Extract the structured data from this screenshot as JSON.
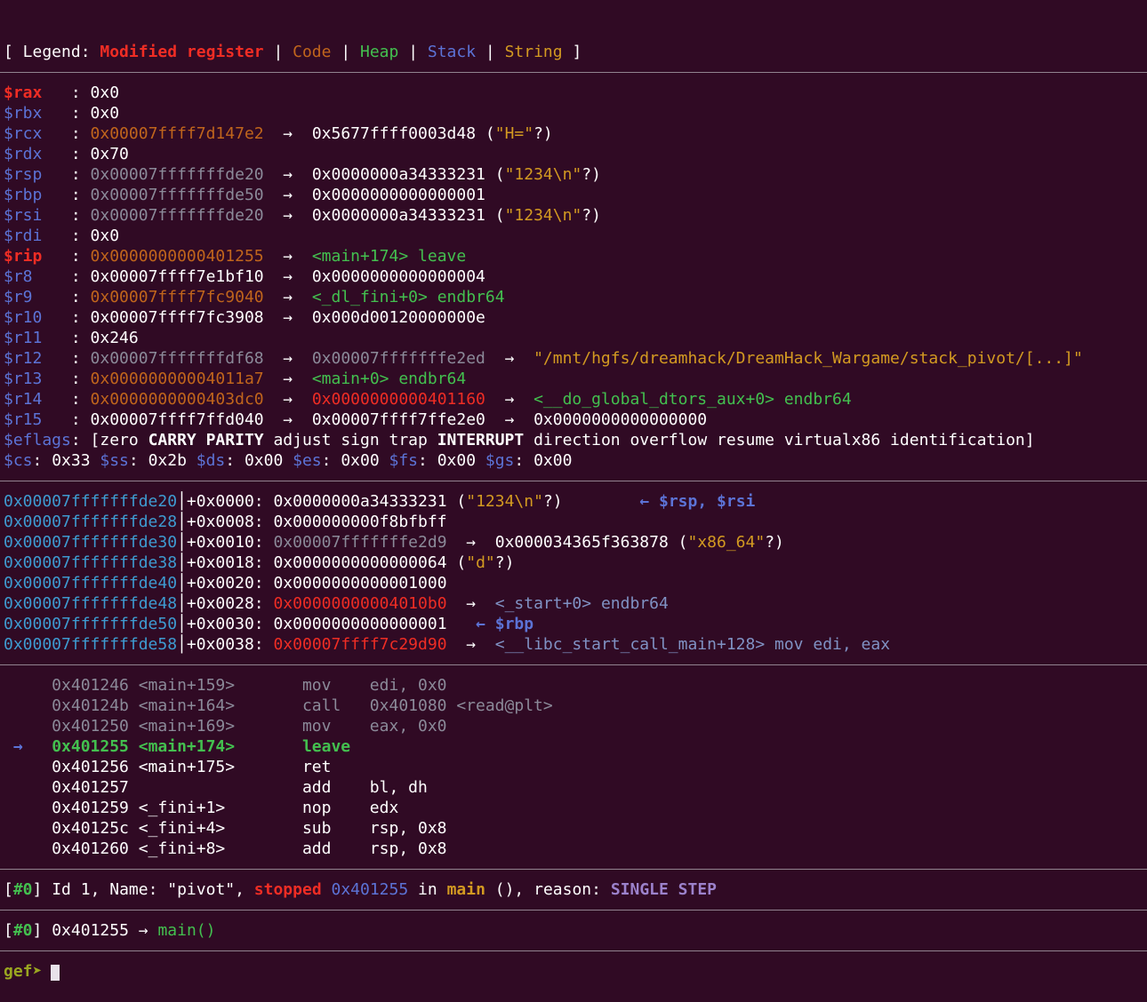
{
  "palette": {
    "bg": "#300a24",
    "fg": "#ffffff",
    "dim": "#8b8a99",
    "red": "#ef2d24",
    "code": "#c0651c",
    "gold": "#d39a21",
    "green": "#43c04f",
    "blue": "#5c73d6",
    "cyan": "#3e9bd1",
    "purple": "#9c82cc",
    "slate": "#8092c4",
    "promptc": "#9aa620",
    "sepc": "#91838f",
    "cursor": "#e8e2ea"
  },
  "prompt": {
    "label": "gef➤"
  },
  "sections": [
    {
      "name": "legend",
      "lines": [
        [
          [
            "[ Legend: ",
            "fg"
          ],
          [
            "Modified register",
            "red",
            1
          ],
          [
            " | ",
            "fg"
          ],
          [
            "Code",
            "code"
          ],
          [
            " | ",
            "fg"
          ],
          [
            "Heap",
            "green"
          ],
          [
            " | ",
            "fg"
          ],
          [
            "Stack",
            "blue"
          ],
          [
            " | ",
            "fg"
          ],
          [
            "String",
            "gold"
          ],
          [
            " ]",
            "fg"
          ]
        ]
      ]
    },
    {
      "name": "separator-1",
      "type": "sep"
    },
    {
      "name": "registers",
      "lines": [
        [
          [
            "$rax",
            "red",
            1
          ],
          [
            "   : ",
            "fg"
          ],
          [
            "0x0",
            "fg"
          ]
        ],
        [
          [
            "$rbx",
            "blue"
          ],
          [
            "   : ",
            "fg"
          ],
          [
            "0x0",
            "fg"
          ]
        ],
        [
          [
            "$rcx",
            "blue"
          ],
          [
            "   : ",
            "fg"
          ],
          [
            "0x00007ffff7d147e2",
            "code"
          ],
          [
            "  →  ",
            "fg"
          ],
          [
            "0x5677ffff0003d48",
            "fg"
          ],
          [
            " (",
            "fg"
          ],
          [
            "\"H=\"",
            "gold"
          ],
          [
            "?)",
            "fg"
          ]
        ],
        [
          [
            "$rdx",
            "blue"
          ],
          [
            "   : ",
            "fg"
          ],
          [
            "0x70",
            "fg"
          ]
        ],
        [
          [
            "$rsp",
            "blue"
          ],
          [
            "   : ",
            "fg"
          ],
          [
            "0x00007fffffffde20",
            "dim"
          ],
          [
            "  →  ",
            "fg"
          ],
          [
            "0x0000000a34333231",
            "fg"
          ],
          [
            " (",
            "fg"
          ],
          [
            "\"1234\\n\"",
            "gold"
          ],
          [
            "?)",
            "fg"
          ]
        ],
        [
          [
            "$rbp",
            "blue"
          ],
          [
            "   : ",
            "fg"
          ],
          [
            "0x00007fffffffde50",
            "dim"
          ],
          [
            "  →  ",
            "fg"
          ],
          [
            "0x0000000000000001",
            "fg"
          ]
        ],
        [
          [
            "$rsi",
            "blue"
          ],
          [
            "   : ",
            "fg"
          ],
          [
            "0x00007fffffffde20",
            "dim"
          ],
          [
            "  →  ",
            "fg"
          ],
          [
            "0x0000000a34333231",
            "fg"
          ],
          [
            " (",
            "fg"
          ],
          [
            "\"1234\\n\"",
            "gold"
          ],
          [
            "?)",
            "fg"
          ]
        ],
        [
          [
            "$rdi",
            "blue"
          ],
          [
            "   : ",
            "fg"
          ],
          [
            "0x0",
            "fg"
          ]
        ],
        [
          [
            "$rip",
            "red",
            1
          ],
          [
            "   : ",
            "fg"
          ],
          [
            "0x0000000000401255",
            "code"
          ],
          [
            "  →  ",
            "fg"
          ],
          [
            "<main+174> leave",
            "green"
          ]
        ],
        [
          [
            "$r8",
            "blue"
          ],
          [
            "    : ",
            "fg"
          ],
          [
            "0x00007ffff7e1bf10",
            "fg"
          ],
          [
            "  →  ",
            "fg"
          ],
          [
            "0x0000000000000004",
            "fg"
          ]
        ],
        [
          [
            "$r9",
            "blue"
          ],
          [
            "    : ",
            "fg"
          ],
          [
            "0x00007ffff7fc9040",
            "code"
          ],
          [
            "  →  ",
            "fg"
          ],
          [
            "<_dl_fini+0> endbr64",
            "green"
          ]
        ],
        [
          [
            "$r10",
            "blue"
          ],
          [
            "   : ",
            "fg"
          ],
          [
            "0x00007ffff7fc3908",
            "fg"
          ],
          [
            "  →  ",
            "fg"
          ],
          [
            "0x000d00120000000e",
            "fg"
          ]
        ],
        [
          [
            "$r11",
            "blue"
          ],
          [
            "   : ",
            "fg"
          ],
          [
            "0x246",
            "fg"
          ]
        ],
        [
          [
            "$r12",
            "blue"
          ],
          [
            "   : ",
            "fg"
          ],
          [
            "0x00007fffffffdf68",
            "dim"
          ],
          [
            "  →  ",
            "fg"
          ],
          [
            "0x00007fffffffe2ed",
            "dim"
          ],
          [
            "  →  ",
            "fg"
          ],
          [
            "\"/mnt/hgfs/dreamhack/DreamHack_Wargame/stack_pivot/[...]\"",
            "gold"
          ]
        ],
        [
          [
            "$r13",
            "blue"
          ],
          [
            "   : ",
            "fg"
          ],
          [
            "0x00000000004011a7",
            "code"
          ],
          [
            "  →  ",
            "fg"
          ],
          [
            "<main+0> endbr64",
            "green"
          ]
        ],
        [
          [
            "$r14",
            "blue"
          ],
          [
            "   : ",
            "fg"
          ],
          [
            "0x0000000000403dc0",
            "code"
          ],
          [
            "  →  ",
            "fg"
          ],
          [
            "0x0000000000401160",
            "red"
          ],
          [
            "  →  ",
            "fg"
          ],
          [
            "<__do_global_dtors_aux+0> endbr64",
            "green"
          ]
        ],
        [
          [
            "$r15",
            "blue"
          ],
          [
            "   : ",
            "fg"
          ],
          [
            "0x00007ffff7ffd040",
            "fg"
          ],
          [
            "  →  ",
            "fg"
          ],
          [
            "0x00007ffff7ffe2e0",
            "fg"
          ],
          [
            "  →  ",
            "fg"
          ],
          [
            "0x0000000000000000",
            "fg"
          ]
        ],
        [
          [
            "$eflags",
            "blue"
          ],
          [
            ": [",
            "fg"
          ],
          [
            "zero ",
            "fg"
          ],
          [
            "CARRY",
            "fg",
            1
          ],
          [
            " ",
            "fg"
          ],
          [
            "PARITY",
            "fg",
            1
          ],
          [
            " adjust sign trap ",
            "fg"
          ],
          [
            "INTERRUPT",
            "fg",
            1
          ],
          [
            " direction overflow resume virtualx86 identification]",
            "fg"
          ]
        ],
        [
          [
            "$cs",
            "blue"
          ],
          [
            ": 0x33 ",
            "fg"
          ],
          [
            "$ss",
            "blue"
          ],
          [
            ": 0x2b ",
            "fg"
          ],
          [
            "$ds",
            "blue"
          ],
          [
            ": 0x00 ",
            "fg"
          ],
          [
            "$es",
            "blue"
          ],
          [
            ": 0x00 ",
            "fg"
          ],
          [
            "$fs",
            "blue"
          ],
          [
            ": 0x00 ",
            "fg"
          ],
          [
            "$gs",
            "blue"
          ],
          [
            ": 0x00",
            "fg"
          ]
        ]
      ]
    },
    {
      "name": "separator-2",
      "type": "sep"
    },
    {
      "name": "stack",
      "lines": [
        [
          [
            "0x00007fffffffde20",
            "cyan"
          ],
          [
            "│",
            "fg"
          ],
          [
            "+0x0000: ",
            "fg"
          ],
          [
            "0x0000000a34333231",
            "fg"
          ],
          [
            " (",
            "fg"
          ],
          [
            "\"1234\\n\"",
            "gold"
          ],
          [
            "?)",
            "fg"
          ],
          [
            "        ",
            "fg"
          ],
          [
            "← $rsp, $rsi",
            "blue",
            1
          ]
        ],
        [
          [
            "0x00007fffffffde28",
            "cyan"
          ],
          [
            "│",
            "fg"
          ],
          [
            "+0x0008: ",
            "fg"
          ],
          [
            "0x000000000f8bfbff",
            "fg"
          ]
        ],
        [
          [
            "0x00007fffffffde30",
            "cyan"
          ],
          [
            "│",
            "fg"
          ],
          [
            "+0x0010: ",
            "fg"
          ],
          [
            "0x00007fffffffe2d9",
            "dim"
          ],
          [
            "  →  ",
            "fg"
          ],
          [
            "0x000034365f363878",
            "fg"
          ],
          [
            " (",
            "fg"
          ],
          [
            "\"x86_64\"",
            "gold"
          ],
          [
            "?)",
            "fg"
          ]
        ],
        [
          [
            "0x00007fffffffde38",
            "cyan"
          ],
          [
            "│",
            "fg"
          ],
          [
            "+0x0018: ",
            "fg"
          ],
          [
            "0x0000000000000064",
            "fg"
          ],
          [
            " (",
            "fg"
          ],
          [
            "\"d\"",
            "gold"
          ],
          [
            "?)",
            "fg"
          ]
        ],
        [
          [
            "0x00007fffffffde40",
            "cyan"
          ],
          [
            "│",
            "fg"
          ],
          [
            "+0x0020: ",
            "fg"
          ],
          [
            "0x0000000000001000",
            "fg"
          ]
        ],
        [
          [
            "0x00007fffffffde48",
            "cyan"
          ],
          [
            "│",
            "fg"
          ],
          [
            "+0x0028: ",
            "fg"
          ],
          [
            "0x00000000004010b0",
            "red"
          ],
          [
            "  →  ",
            "fg"
          ],
          [
            "<_start+0> endbr64",
            "slate"
          ]
        ],
        [
          [
            "0x00007fffffffde50",
            "cyan"
          ],
          [
            "│",
            "fg"
          ],
          [
            "+0x0030: ",
            "fg"
          ],
          [
            "0x0000000000000001",
            "fg"
          ],
          [
            "   ",
            "fg"
          ],
          [
            "← $rbp",
            "blue",
            1
          ]
        ],
        [
          [
            "0x00007fffffffde58",
            "cyan"
          ],
          [
            "│",
            "fg"
          ],
          [
            "+0x0038: ",
            "fg"
          ],
          [
            "0x00007ffff7c29d90",
            "red"
          ],
          [
            "  →  ",
            "fg"
          ],
          [
            "<__libc_start_call_main+128> mov edi, eax",
            "slate"
          ]
        ]
      ]
    },
    {
      "name": "separator-3",
      "type": "sep"
    },
    {
      "name": "code",
      "lines": [
        [
          [
            "     0x401246 <main+159>       mov    edi, 0x0",
            "dim"
          ]
        ],
        [
          [
            "     0x40124b <main+164>       call   0x401080 <read@plt>",
            "dim"
          ]
        ],
        [
          [
            "     0x401250 <main+169>       mov    eax, 0x0",
            "dim"
          ]
        ],
        [
          [
            " → ",
            "blue",
            1
          ],
          [
            "  ",
            "fg"
          ],
          [
            "0x401255 <main+174>       leave",
            "green",
            1
          ]
        ],
        [
          [
            "     0x401256 <main+175>       ret",
            "fg"
          ]
        ],
        [
          [
            "     0x401257                  add    bl, dh",
            "fg"
          ]
        ],
        [
          [
            "     0x401259 <_fini+1>        nop    edx",
            "fg"
          ]
        ],
        [
          [
            "     0x40125c <_fini+4>        sub    rsp, 0x8",
            "fg"
          ]
        ],
        [
          [
            "     0x401260 <_fini+8>        add    rsp, 0x8",
            "fg"
          ]
        ]
      ]
    },
    {
      "name": "separator-4",
      "type": "sep"
    },
    {
      "name": "threads",
      "lines": [
        [
          [
            "[",
            "fg"
          ],
          [
            "#0",
            "green",
            1
          ],
          [
            "] ",
            "fg"
          ],
          [
            "Id 1, Name: \"pivot\", ",
            "fg"
          ],
          [
            "stopped",
            "red",
            1
          ],
          [
            " ",
            "fg"
          ],
          [
            "0x401255",
            "blue"
          ],
          [
            " in ",
            "fg"
          ],
          [
            "main",
            "gold",
            1
          ],
          [
            " (), reason: ",
            "fg"
          ],
          [
            "SINGLE STEP",
            "purple",
            1
          ]
        ]
      ]
    },
    {
      "name": "separator-5",
      "type": "sep"
    },
    {
      "name": "trace",
      "lines": [
        [
          [
            "[",
            "fg"
          ],
          [
            "#0",
            "green",
            1
          ],
          [
            "] ",
            "fg"
          ],
          [
            "0x401255",
            "fg"
          ],
          [
            " → ",
            "fg"
          ],
          [
            "main()",
            "green"
          ]
        ]
      ]
    },
    {
      "name": "separator-6",
      "type": "sep"
    }
  ]
}
